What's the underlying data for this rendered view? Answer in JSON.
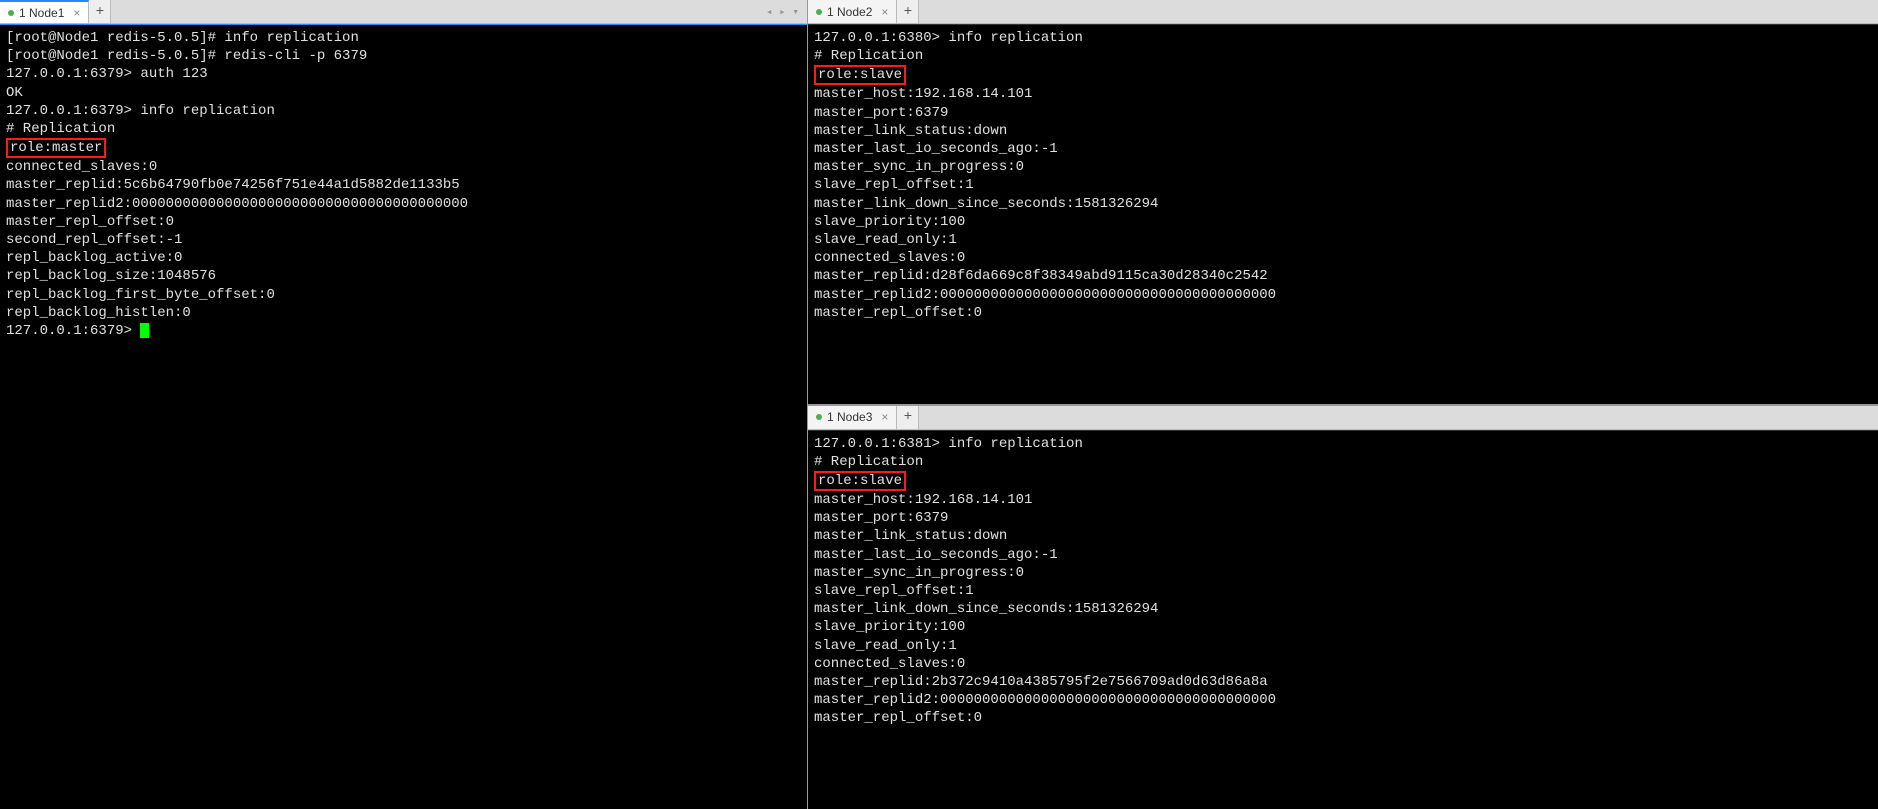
{
  "panels": {
    "left": {
      "tab": {
        "label": "1 Node1",
        "active": true
      },
      "lines": [
        "[root@Node1 redis-5.0.5]# info replication",
        "",
        "[root@Node1 redis-5.0.5]# redis-cli -p 6379",
        "127.0.0.1:6379> auth 123",
        "OK",
        "127.0.0.1:6379> info replication",
        "# Replication"
      ],
      "highlight": "role:master",
      "lines_after": [
        "connected_slaves:0",
        "master_replid:5c6b64790fb0e74256f751e44a1d5882de1133b5",
        "master_replid2:0000000000000000000000000000000000000000",
        "master_repl_offset:0",
        "second_repl_offset:-1",
        "repl_backlog_active:0",
        "repl_backlog_size:1048576",
        "repl_backlog_first_byte_offset:0",
        "repl_backlog_histlen:0"
      ],
      "prompt": "127.0.0.1:6379> "
    },
    "right_top": {
      "tab": {
        "label": "1 Node2",
        "active": false
      },
      "lines": [
        "127.0.0.1:6380> info replication",
        "# Replication"
      ],
      "highlight": "role:slave",
      "lines_after": [
        "master_host:192.168.14.101",
        "master_port:6379",
        "master_link_status:down",
        "master_last_io_seconds_ago:-1",
        "master_sync_in_progress:0",
        "slave_repl_offset:1",
        "master_link_down_since_seconds:1581326294",
        "slave_priority:100",
        "slave_read_only:1",
        "connected_slaves:0",
        "master_replid:d28f6da669c8f38349abd9115ca30d28340c2542",
        "master_replid2:0000000000000000000000000000000000000000",
        "master_repl_offset:0"
      ]
    },
    "right_bottom": {
      "tab": {
        "label": "1 Node3",
        "active": false
      },
      "lines": [
        "127.0.0.1:6381> info replication",
        "# Replication"
      ],
      "highlight": "role:slave",
      "lines_after": [
        "master_host:192.168.14.101",
        "master_port:6379",
        "master_link_status:down",
        "master_last_io_seconds_ago:-1",
        "master_sync_in_progress:0",
        "slave_repl_offset:1",
        "master_link_down_since_seconds:1581326294",
        "slave_priority:100",
        "slave_read_only:1",
        "connected_slaves:0",
        "master_replid:2b372c9410a4385795f2e7566709ad0d63d86a8a",
        "master_replid2:0000000000000000000000000000000000000000",
        "master_repl_offset:0"
      ]
    }
  },
  "icons": {
    "add": "+",
    "close": "×",
    "nav": "◂ ▸ ▾"
  }
}
